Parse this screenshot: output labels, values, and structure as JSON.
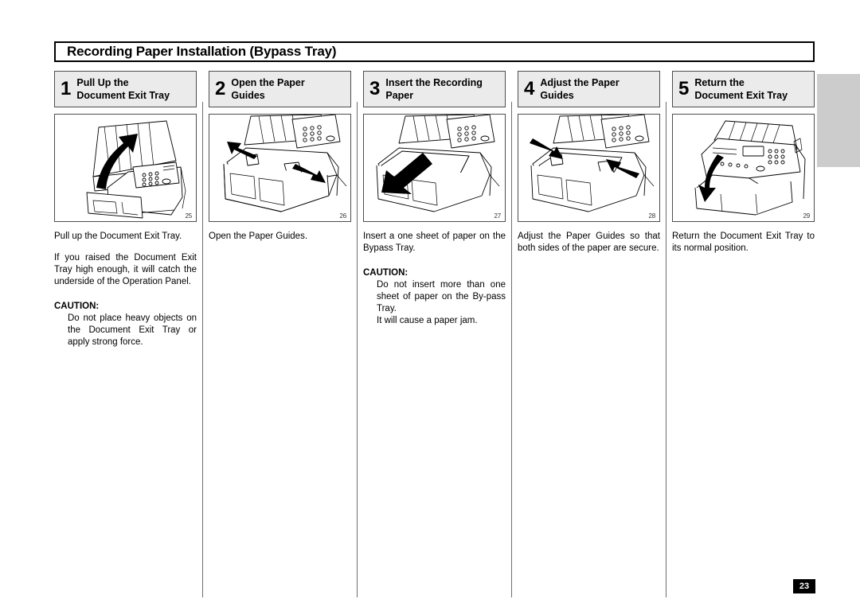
{
  "document": {
    "title": "Recording Paper Installation (Bypass Tray)",
    "page_number": "23"
  },
  "steps": [
    {
      "number": "1",
      "label": "Pull Up the\nDocument Exit Tray",
      "label_line1": "Pull Up the",
      "label_line2": "Document Exit Tray",
      "figure_number": "25",
      "figure_alt": "fax-machine-document-exit-tray-pulled-up",
      "paragraphs": [
        "Pull up the Document Exit Tray.",
        "If you raised the Document Exit Tray high enough, it will catch the underside of the Operation Panel."
      ],
      "caution": {
        "heading": "CAUTION:",
        "text": "Do not place heavy objects on the Document Exit Tray or apply strong force."
      }
    },
    {
      "number": "2",
      "label": "Open the Paper\nGuides",
      "label_line1": "Open the Paper",
      "label_line2": "Guides",
      "figure_number": "26",
      "figure_alt": "paper-guides-opened-outward",
      "paragraphs": [
        "Open the Paper Guides."
      ],
      "caution": null
    },
    {
      "number": "3",
      "label": "Insert the Recording\nPaper",
      "label_line1": "Insert the Recording",
      "label_line2": "Paper",
      "figure_number": "27",
      "figure_alt": "recording-paper-inserted-into-bypass-tray",
      "paragraphs": [
        "Insert a one sheet of paper on the Bypass Tray."
      ],
      "caution": {
        "heading": "CAUTION:",
        "text": "Do not insert more than one sheet of paper on the By-pass Tray.",
        "text2": "It will cause a paper jam."
      }
    },
    {
      "number": "4",
      "label": "Adjust the Paper\nGuides",
      "label_line1": "Adjust the Paper",
      "label_line2": "Guides",
      "figure_number": "28",
      "figure_alt": "paper-guides-adjusted-inward-against-paper",
      "paragraphs": [
        "Adjust the Paper Guides so that both sides of the paper are secure."
      ],
      "caution": null
    },
    {
      "number": "5",
      "label": "Return the\nDocument Exit Tray",
      "label_line1": "Return the",
      "label_line2": "Document Exit Tray",
      "figure_number": "29",
      "figure_alt": "document-exit-tray-returned-to-normal-position",
      "paragraphs": [
        "Return the Document Exit Tray to its normal position."
      ],
      "caution": null
    }
  ],
  "colors": {
    "step_header_fill": "#ebebeb",
    "border": "#4d4d4d",
    "edge_tab": "#cccccc",
    "page_badge": "#000000"
  }
}
